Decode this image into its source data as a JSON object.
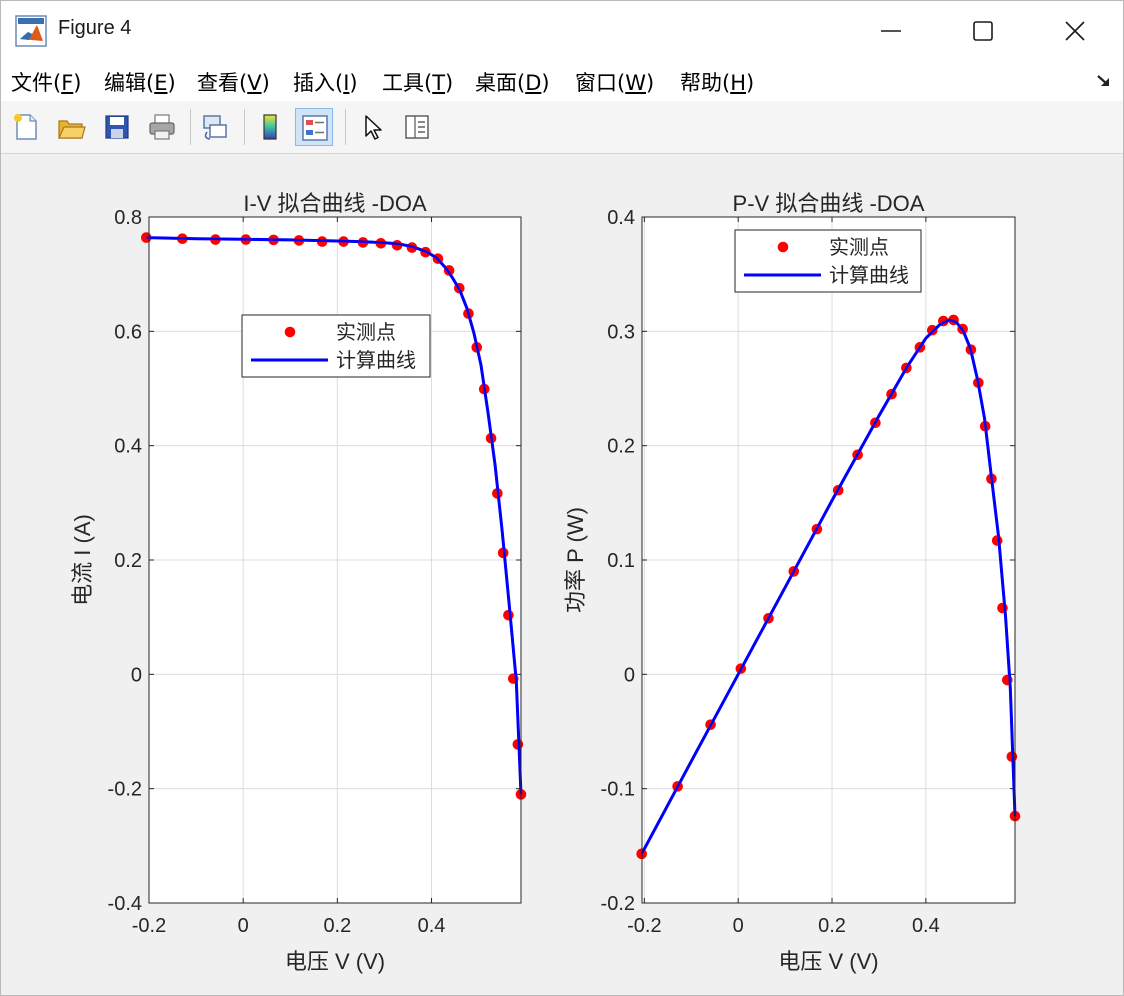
{
  "window": {
    "title": "Figure 4"
  },
  "menu": [
    {
      "label": "文件(",
      "key": "F",
      "tail": ")"
    },
    {
      "label": "编辑(",
      "key": "E",
      "tail": ")"
    },
    {
      "label": "查看(",
      "key": "V",
      "tail": ")"
    },
    {
      "label": "插入(",
      "key": "I",
      "tail": ")"
    },
    {
      "label": "工具(",
      "key": "T",
      "tail": ")"
    },
    {
      "label": "桌面(",
      "key": "D",
      "tail": ")"
    },
    {
      "label": "窗口(",
      "key": "W",
      "tail": ")"
    },
    {
      "label": "帮助(",
      "key": "H",
      "tail": ")"
    }
  ],
  "toolbar": [
    {
      "name": "new-figure-icon"
    },
    {
      "name": "open-file-icon"
    },
    {
      "name": "save-icon"
    },
    {
      "name": "print-icon"
    },
    {
      "name": "link-plot-icon"
    },
    {
      "name": "colorbar-icon"
    },
    {
      "name": "legend-icon",
      "active": true
    },
    {
      "name": "pointer-icon"
    },
    {
      "name": "property-inspector-icon"
    }
  ],
  "colors": {
    "points": "#ff0000",
    "curve": "#0000ff"
  },
  "chart_data": [
    {
      "type": "line",
      "title": "I-V 拟合曲线 -DOA",
      "xlabel": "电压 V (V)",
      "ylabel": "电流 I (A)",
      "xlim": [
        -0.2,
        0.59
      ],
      "ylim": [
        -0.4,
        0.8
      ],
      "xticks": [
        "-0.2",
        "0",
        "0.2",
        "0.4"
      ],
      "yticks": [
        "-0.4",
        "-0.2",
        "0",
        "0.2",
        "0.4",
        "0.6",
        "0.8"
      ],
      "xtick_values": [
        -0.2,
        0,
        0.2,
        0.4
      ],
      "ytick_values": [
        -0.4,
        -0.2,
        0,
        0.2,
        0.4,
        0.6,
        0.8
      ],
      "grid": true,
      "legend": {
        "position": "upper-center",
        "entries": [
          "实测点",
          "计算曲线"
        ]
      },
      "series": [
        {
          "name": "实测点",
          "kind": "scatter",
          "x": [
            -0.2057,
            -0.1291,
            -0.0588,
            0.0057,
            0.0646,
            0.1185,
            0.1678,
            0.2132,
            0.2545,
            0.2924,
            0.3269,
            0.3585,
            0.3873,
            0.4137,
            0.4373,
            0.459,
            0.4784,
            0.496,
            0.5119,
            0.5265,
            0.5398,
            0.5521,
            0.5633,
            0.5736,
            0.5833,
            0.59
          ],
          "y": [
            0.764,
            0.762,
            0.7605,
            0.7605,
            0.76,
            0.759,
            0.757,
            0.757,
            0.7555,
            0.754,
            0.7505,
            0.7465,
            0.7385,
            0.727,
            0.7065,
            0.6755,
            0.631,
            0.572,
            0.499,
            0.413,
            0.3165,
            0.2125,
            0.1035,
            -0.0075,
            -0.1225,
            -0.21
          ]
        },
        {
          "name": "计算曲线",
          "kind": "line",
          "x": [
            -0.2057,
            -0.1,
            0.0,
            0.1,
            0.2,
            0.25,
            0.3,
            0.33,
            0.36,
            0.39,
            0.41,
            0.43,
            0.445,
            0.46,
            0.475,
            0.49,
            0.505,
            0.52,
            0.535,
            0.55,
            0.565,
            0.58,
            0.59
          ],
          "y": [
            0.764,
            0.762,
            0.761,
            0.76,
            0.758,
            0.757,
            0.755,
            0.753,
            0.748,
            0.739,
            0.729,
            0.711,
            0.693,
            0.672,
            0.641,
            0.597,
            0.541,
            0.458,
            0.366,
            0.25,
            0.122,
            -0.012,
            -0.21
          ]
        }
      ]
    },
    {
      "type": "line",
      "title": "P-V 拟合曲线 -DOA",
      "xlabel": "电压 V (V)",
      "ylabel": "功率 P (W)",
      "xlim": [
        -0.205,
        0.59
      ],
      "ylim": [
        -0.2,
        0.4
      ],
      "xticks": [
        "-0.2",
        "0",
        "0.2",
        "0.4"
      ],
      "yticks": [
        "-0.2",
        "-0.1",
        "0",
        "0.1",
        "0.2",
        "0.3",
        "0.4"
      ],
      "xtick_values": [
        -0.2,
        0,
        0.2,
        0.4
      ],
      "ytick_values": [
        -0.2,
        -0.1,
        0,
        0.1,
        0.2,
        0.3,
        0.4
      ],
      "grid": true,
      "legend": {
        "position": "top-center",
        "entries": [
          "实测点",
          "计算曲线"
        ]
      },
      "series": [
        {
          "name": "实测点",
          "kind": "scatter",
          "x": [
            -0.2057,
            -0.1291,
            -0.0588,
            0.0057,
            0.0646,
            0.1185,
            0.1678,
            0.2132,
            0.2545,
            0.2924,
            0.3269,
            0.3585,
            0.3873,
            0.4137,
            0.4373,
            0.459,
            0.4784,
            0.496,
            0.5119,
            0.5265,
            0.5398,
            0.5521,
            0.5633,
            0.5736,
            0.5833,
            0.59
          ],
          "y": [
            -0.157,
            -0.098,
            -0.044,
            0.005,
            0.049,
            0.09,
            0.127,
            0.161,
            0.192,
            0.22,
            0.245,
            0.268,
            0.286,
            0.301,
            0.309,
            0.31,
            0.302,
            0.284,
            0.255,
            0.217,
            0.171,
            0.117,
            0.058,
            -0.005,
            -0.072,
            -0.124
          ]
        },
        {
          "name": "计算曲线",
          "kind": "line",
          "x": [
            -0.2057,
            -0.1,
            0.0,
            0.1,
            0.2,
            0.3,
            0.36,
            0.4,
            0.43,
            0.45,
            0.465,
            0.48,
            0.495,
            0.51,
            0.525,
            0.54,
            0.555,
            0.57,
            0.58,
            0.59
          ],
          "y": [
            -0.157,
            -0.076,
            0.0,
            0.076,
            0.152,
            0.226,
            0.269,
            0.294,
            0.306,
            0.31,
            0.308,
            0.3,
            0.285,
            0.258,
            0.224,
            0.172,
            0.12,
            0.05,
            -0.012,
            -0.124
          ]
        }
      ]
    }
  ]
}
